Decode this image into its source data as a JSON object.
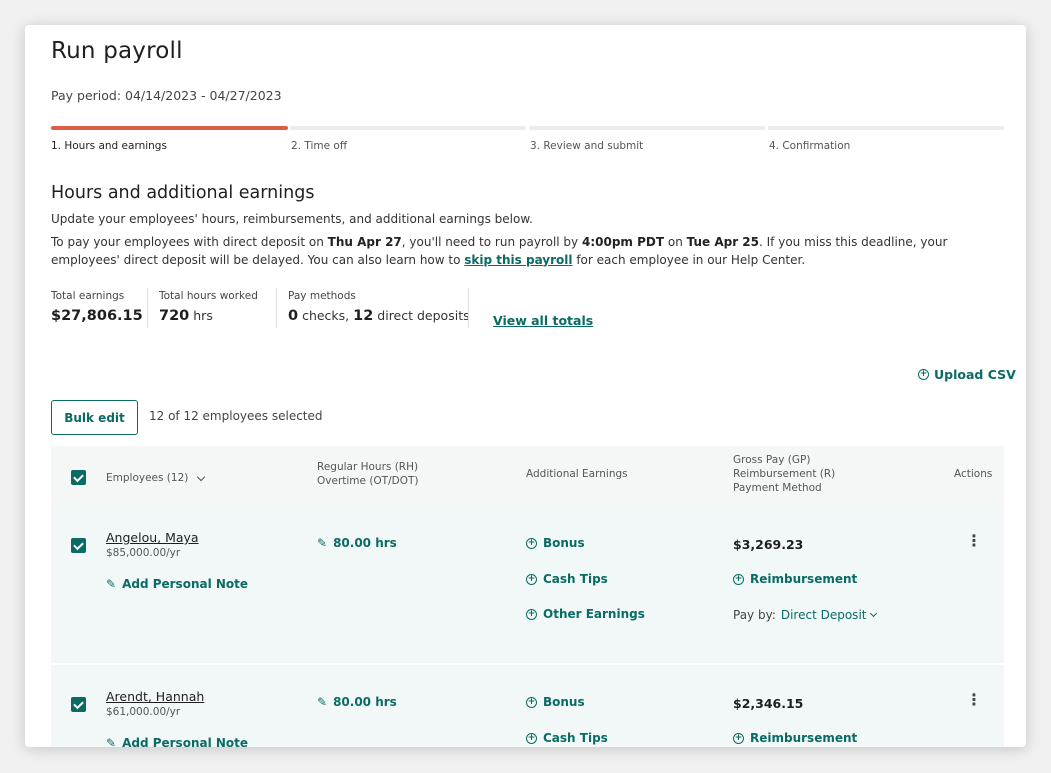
{
  "page": {
    "title": "Run payroll",
    "pay_period": "Pay period: 04/14/2023 - 04/27/2023"
  },
  "steps": [
    {
      "label": "1. Hours and earnings",
      "active": true
    },
    {
      "label": "2. Time off",
      "active": false
    },
    {
      "label": "3. Review and submit",
      "active": false
    },
    {
      "label": "4. Confirmation",
      "active": false
    }
  ],
  "section": {
    "title": "Hours and additional earnings",
    "subtitle": "Update your employees' hours, reimbursements, and additional earnings below.",
    "deadline": {
      "p1": "To pay your employees with direct deposit on ",
      "date1": "Thu Apr 27",
      "p2": ", you'll need to run payroll by ",
      "time": "4:00pm PDT",
      "p3": " on ",
      "date2": "Tue Apr 25",
      "p4": ". If you miss this deadline, your employees' direct deposit will be delayed. You can also learn how to ",
      "link": "skip this payroll",
      "p5": " for each employee in our Help Center."
    }
  },
  "totals": {
    "earnings_label": "Total earnings",
    "earnings_value": "$27,806.15",
    "hours_label": "Total hours worked",
    "hours_value": "720",
    "hours_unit": " hrs",
    "methods_label": "Pay methods",
    "checks_count": "0",
    "checks_label": " checks, ",
    "deposits_count": "12",
    "deposits_label": " direct deposits",
    "view_all": "View all totals"
  },
  "toolbar": {
    "upload_csv": "Upload CSV",
    "bulk_edit": "Bulk edit",
    "selected": "12 of 12 employees selected"
  },
  "table": {
    "headers": {
      "employees": "Employees (12)",
      "hours_l1": "Regular Hours (RH)",
      "hours_l2": "Overtime (OT/DOT)",
      "additional": "Additional Earnings",
      "gross_l1": "Gross Pay (GP)",
      "gross_l2": "Reimbursement (R)",
      "gross_l3": "Payment Method",
      "actions": "Actions"
    },
    "rows": [
      {
        "name": "Angelou, Maya",
        "salary": "$85,000.00/yr",
        "note": "Add Personal Note",
        "hours": "80.00 hrs",
        "bonus": "Bonus",
        "cash_tips": "Cash Tips",
        "other": "Other Earnings",
        "gross": "$3,269.23",
        "reimbursement": "Reimbursement",
        "pay_by_label": "Pay by:",
        "pay_by_value": "Direct Deposit"
      },
      {
        "name": "Arendt, Hannah",
        "salary": "$61,000.00/yr",
        "note": "Add Personal Note",
        "hours": "80.00 hrs",
        "bonus": "Bonus",
        "cash_tips": "Cash Tips",
        "gross": "$2,346.15",
        "reimbursement": "Reimbursement"
      }
    ]
  },
  "colors": {
    "accent": "#0a6b64",
    "progress": "#e05d45"
  }
}
